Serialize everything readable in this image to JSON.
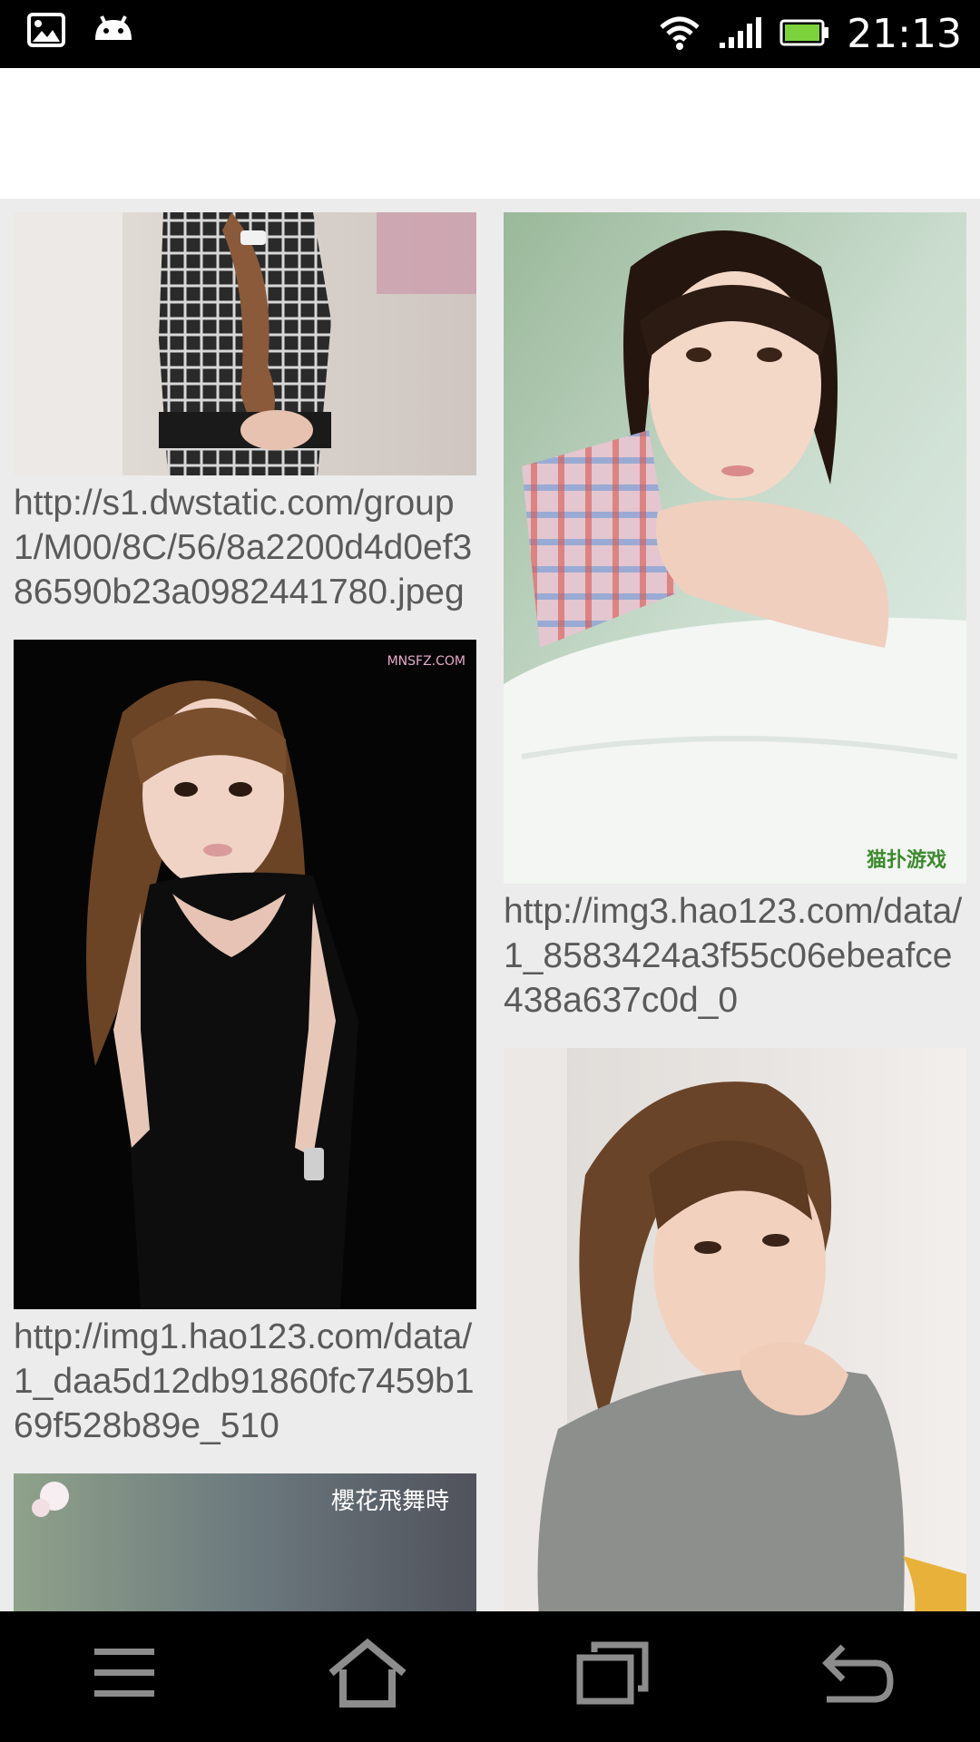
{
  "status_bar": {
    "time": "21:13",
    "icons": [
      "gallery-notification-icon",
      "android-notification-icon",
      "wifi-icon",
      "signal-icon",
      "battery-icon"
    ],
    "battery_color": "#7bd23a"
  },
  "feed": {
    "left": [
      {
        "caption": "http://s1.dwstatic.com/group1/M00/8C/56/8a2200d4d0ef386590b23a0982441780.jpeg",
        "photo": "woman-lace-dress-photo"
      },
      {
        "caption": "http://img1.hao123.com/data/1_daa5d12db91860fc7459b169f528b89e_510",
        "photo": "woman-black-dress-photo",
        "watermark": "MNSFZ.COM"
      },
      {
        "caption": "",
        "photo": "cherry-blossom-photo",
        "watermark": "櫻花飛舞時"
      }
    ],
    "right": [
      {
        "caption": "http://img3.hao123.com/data/1_8583424a3f55c06ebeafce438a637c0d_0",
        "photo": "girl-plaid-shirt-photo",
        "watermark": "猫扑游戏"
      },
      {
        "caption": "",
        "photo": "woman-gray-shirt-photo"
      }
    ]
  },
  "nav_bar": {
    "buttons": [
      "menu-icon",
      "home-icon",
      "recent-apps-icon",
      "back-icon"
    ]
  }
}
